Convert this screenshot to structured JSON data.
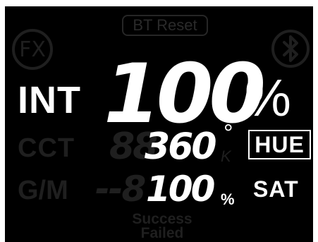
{
  "header": {
    "bt_reset_label": "BT Reset",
    "fx_icon_text": "FX"
  },
  "intensity": {
    "label": "INT",
    "value": "100",
    "unit": "%"
  },
  "cct": {
    "label": "CCT",
    "ghost_digits": "88",
    "hue_value": "360",
    "degree": "°",
    "kelvin_unit": "K"
  },
  "gm": {
    "label": "G/M",
    "ghost_digits": "--8",
    "sat_value": "100",
    "unit": "%"
  },
  "mode": {
    "hue_label": "HUE",
    "sat_label": "SAT"
  },
  "status": {
    "success": "Success",
    "failed": "Failed"
  },
  "colors": {
    "background": "#000000",
    "active": "#ffffff",
    "inactive": "#1f1f1f"
  },
  "icons": [
    "fx-icon",
    "bluetooth-icon"
  ]
}
